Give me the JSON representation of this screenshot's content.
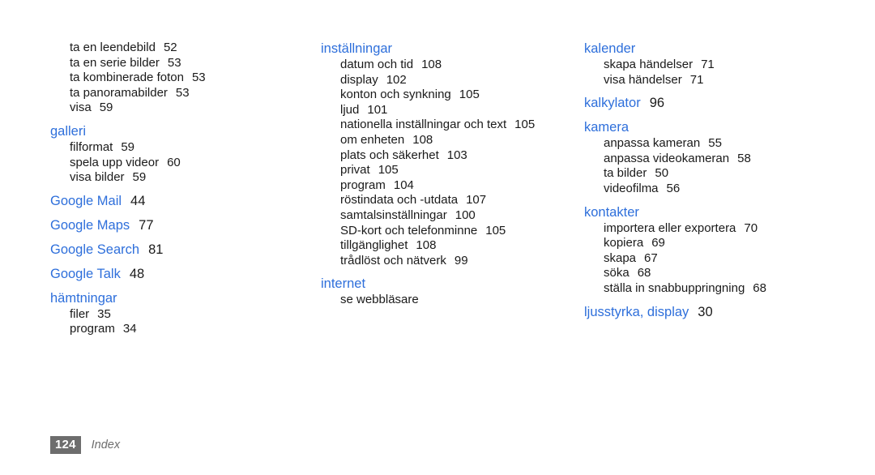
{
  "document": {
    "kind": "index-page",
    "footer": {
      "page_number": "124",
      "section_label": "Index"
    },
    "colors": {
      "heading_blue": "#2e6fdb",
      "body_text": "#1a1a1a",
      "folio_background": "#6d6d6d",
      "folio_text": "#ffffff",
      "page_background": "#ffffff"
    }
  },
  "columns": [
    {
      "name": "column-left",
      "groups": [
        {
          "heading": null,
          "entries": [
            {
              "label": "ta en leendebild",
              "page": "52"
            },
            {
              "label": "ta en serie bilder",
              "page": "53"
            },
            {
              "label": "ta kombinerade foton",
              "page": "53"
            },
            {
              "label": "ta panoramabilder",
              "page": "53"
            },
            {
              "label": "visa",
              "page": "59"
            }
          ]
        },
        {
          "heading": {
            "label": "galleri",
            "page": ""
          },
          "entries": [
            {
              "label": "filformat",
              "page": "59"
            },
            {
              "label": "spela upp videor",
              "page": "60"
            },
            {
              "label": "visa bilder",
              "page": "59"
            }
          ]
        },
        {
          "heading": {
            "label": "Google Mail",
            "page": "44"
          },
          "entries": []
        },
        {
          "heading": {
            "label": "Google Maps",
            "page": "77"
          },
          "entries": []
        },
        {
          "heading": {
            "label": "Google Search",
            "page": "81"
          },
          "entries": []
        },
        {
          "heading": {
            "label": "Google Talk",
            "page": "48"
          },
          "entries": []
        },
        {
          "heading": {
            "label": "hämtningar",
            "page": ""
          },
          "entries": [
            {
              "label": "filer",
              "page": "35"
            },
            {
              "label": "program",
              "page": "34"
            }
          ]
        }
      ]
    },
    {
      "name": "column-middle",
      "groups": [
        {
          "heading": {
            "label": "inställningar",
            "page": ""
          },
          "entries": [
            {
              "label": "datum och tid",
              "page": "108"
            },
            {
              "label": "display",
              "page": "102"
            },
            {
              "label": "konton och synkning",
              "page": "105"
            },
            {
              "label": "ljud",
              "page": "101"
            },
            {
              "label": "nationella inställningar och text",
              "page": "105"
            },
            {
              "label": "om enheten",
              "page": "108"
            },
            {
              "label": "plats och säkerhet",
              "page": "103"
            },
            {
              "label": "privat",
              "page": "105"
            },
            {
              "label": "program",
              "page": "104"
            },
            {
              "label": "röstindata och -utdata",
              "page": "107"
            },
            {
              "label": "samtalsinställningar",
              "page": "100"
            },
            {
              "label": "SD-kort och telefonminne",
              "page": "105"
            },
            {
              "label": "tillgänglighet",
              "page": "108"
            },
            {
              "label": "trådlöst och nätverk",
              "page": "99"
            }
          ]
        },
        {
          "heading": {
            "label": "internet",
            "page": ""
          },
          "entries": [
            {
              "label": "se webbläsare",
              "page": ""
            }
          ]
        }
      ]
    },
    {
      "name": "column-right",
      "groups": [
        {
          "heading": {
            "label": "kalender",
            "page": ""
          },
          "entries": [
            {
              "label": "skapa händelser",
              "page": "71"
            },
            {
              "label": "visa händelser",
              "page": "71"
            }
          ]
        },
        {
          "heading": {
            "label": "kalkylator",
            "page": "96"
          },
          "entries": []
        },
        {
          "heading": {
            "label": "kamera",
            "page": ""
          },
          "entries": [
            {
              "label": "anpassa kameran",
              "page": "55"
            },
            {
              "label": "anpassa videokameran",
              "page": "58"
            },
            {
              "label": "ta bilder",
              "page": "50"
            },
            {
              "label": "videofilma",
              "page": "56"
            }
          ]
        },
        {
          "heading": {
            "label": "kontakter",
            "page": ""
          },
          "entries": [
            {
              "label": "importera eller exportera",
              "page": "70"
            },
            {
              "label": "kopiera",
              "page": "69"
            },
            {
              "label": "skapa",
              "page": "67"
            },
            {
              "label": "söka",
              "page": "68"
            },
            {
              "label": "ställa in snabbuppringning",
              "page": "68"
            }
          ]
        },
        {
          "heading": {
            "label": "ljusstyrka, display",
            "page": "30"
          },
          "entries": []
        }
      ]
    }
  ]
}
